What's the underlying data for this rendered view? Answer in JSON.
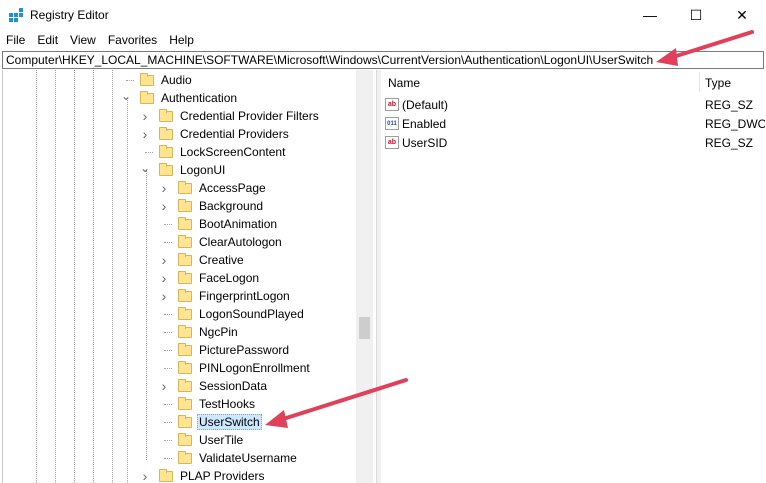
{
  "window": {
    "title": "Registry Editor",
    "minimize_glyph": "—",
    "maximize_glyph": "☐",
    "close_glyph": "✕"
  },
  "menu": [
    "File",
    "Edit",
    "View",
    "Favorites",
    "Help"
  ],
  "address": {
    "path": "Computer\\HKEY_LOCAL_MACHINE\\SOFTWARE\\Microsoft\\Windows\\CurrentVersion\\Authentication\\LogonUI\\UserSwitch"
  },
  "tree": {
    "items": [
      {
        "label": "Audio",
        "depth": 0,
        "expander": ""
      },
      {
        "label": "Authentication",
        "depth": 0,
        "expander": "expanded"
      },
      {
        "label": "Credential Provider Filters",
        "depth": 1,
        "expander": "collapsed"
      },
      {
        "label": "Credential Providers",
        "depth": 1,
        "expander": "collapsed"
      },
      {
        "label": "LockScreenContent",
        "depth": 1,
        "expander": ""
      },
      {
        "label": "LogonUI",
        "depth": 1,
        "expander": "expanded"
      },
      {
        "label": "AccessPage",
        "depth": 2,
        "expander": "collapsed"
      },
      {
        "label": "Background",
        "depth": 2,
        "expander": "collapsed"
      },
      {
        "label": "BootAnimation",
        "depth": 2,
        "expander": ""
      },
      {
        "label": "ClearAutologon",
        "depth": 2,
        "expander": ""
      },
      {
        "label": "Creative",
        "depth": 2,
        "expander": "collapsed"
      },
      {
        "label": "FaceLogon",
        "depth": 2,
        "expander": "collapsed"
      },
      {
        "label": "FingerprintLogon",
        "depth": 2,
        "expander": "collapsed"
      },
      {
        "label": "LogonSoundPlayed",
        "depth": 2,
        "expander": ""
      },
      {
        "label": "NgcPin",
        "depth": 2,
        "expander": ""
      },
      {
        "label": "PicturePassword",
        "depth": 2,
        "expander": ""
      },
      {
        "label": "PINLogonEnrollment",
        "depth": 2,
        "expander": ""
      },
      {
        "label": "SessionData",
        "depth": 2,
        "expander": "collapsed"
      },
      {
        "label": "TestHooks",
        "depth": 2,
        "expander": ""
      },
      {
        "label": "UserSwitch",
        "depth": 2,
        "expander": "",
        "selected": true
      },
      {
        "label": "UserTile",
        "depth": 2,
        "expander": ""
      },
      {
        "label": "ValidateUsername",
        "depth": 2,
        "expander": ""
      },
      {
        "label": "PLAP Providers",
        "depth": 1,
        "expander": "collapsed"
      }
    ]
  },
  "values": {
    "columns": {
      "name": "Name",
      "type": "Type"
    },
    "rows": [
      {
        "name": "(Default)",
        "type": "REG_SZ",
        "icon": "string-value-icon",
        "icon_text": "ab"
      },
      {
        "name": "Enabled",
        "type": "REG_DWOR",
        "icon": "binary-value-icon",
        "icon_text": "011"
      },
      {
        "name": "UserSID",
        "type": "REG_SZ",
        "icon": "string-value-icon",
        "icon_text": "ab"
      }
    ]
  },
  "colors": {
    "arrow": "#e0405a",
    "selection": "#cce8ff",
    "folder": "#ffe491"
  }
}
